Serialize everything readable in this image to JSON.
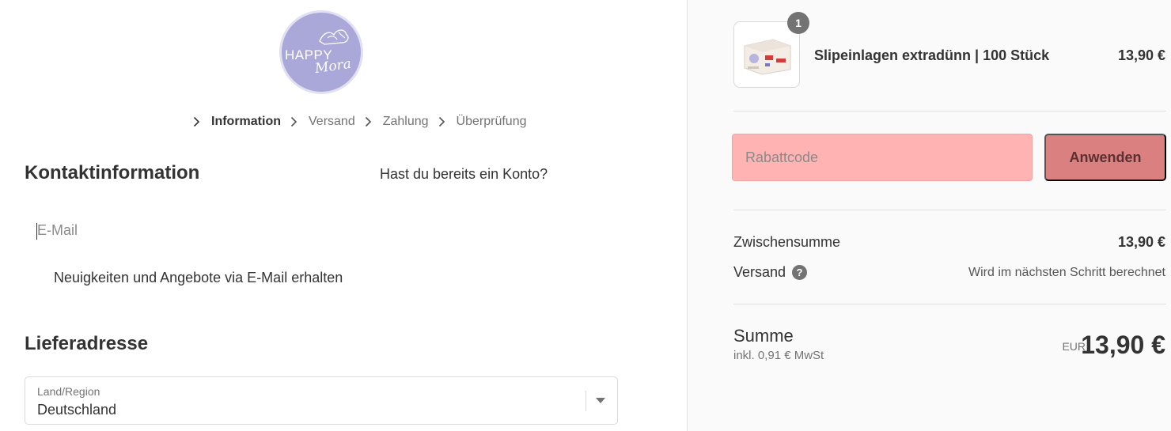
{
  "logo": {
    "line1": "HAPPY",
    "line2": "Mora",
    "color": "#aaa8d8"
  },
  "breadcrumb": {
    "items": [
      {
        "label": "Information",
        "active": true
      },
      {
        "label": "Versand",
        "active": false
      },
      {
        "label": "Zahlung",
        "active": false
      },
      {
        "label": "Überprüfung",
        "active": false
      }
    ],
    "separator_icon": "chevron-right-icon"
  },
  "contact": {
    "heading": "Kontaktinformation",
    "login_link": "Hast du bereits ein Konto?",
    "email_placeholder": "E-Mail",
    "newsletter_label": "Neuigkeiten und Angebote via E-Mail erhalten"
  },
  "shipping_address": {
    "heading": "Lieferadresse",
    "country_label": "Land/Region",
    "country_value": "Deutschland"
  },
  "order_summary": {
    "product": {
      "name": "Slipeinlagen extradünn | 100 Stück",
      "price": "13,90 €",
      "quantity": "1"
    },
    "discount": {
      "placeholder": "Rabattcode",
      "apply_label": "Anwenden",
      "highlight_color": "#ffb3b3",
      "button_color": "#db8080"
    },
    "subtotal_label": "Zwischensumme",
    "subtotal_value": "13,90 €",
    "shipping_label": "Versand",
    "shipping_value": "Wird im nächsten Schritt berechnet",
    "total_label": "Summe",
    "tax_note": "inkl. 0,91 € MwSt",
    "currency": "EUR",
    "total_value": "13,90 €"
  }
}
